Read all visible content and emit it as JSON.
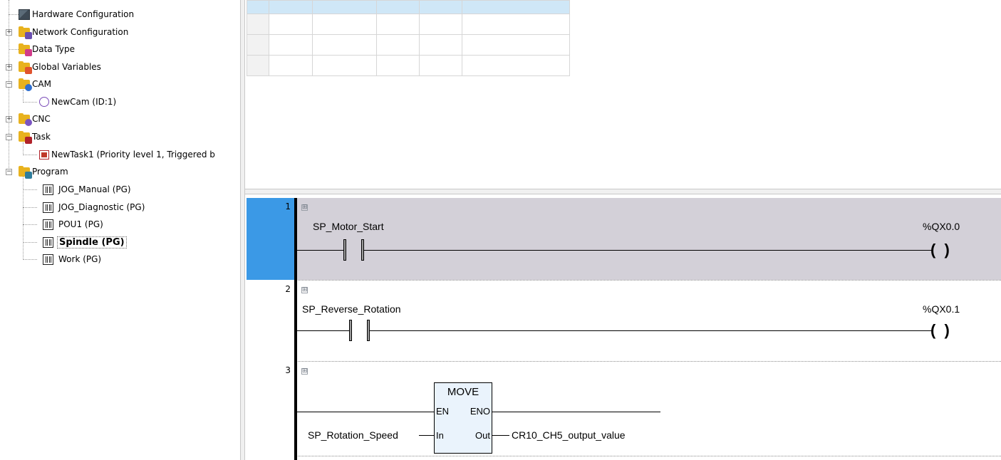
{
  "tree": {
    "items": [
      {
        "label": "Hardware Configuration",
        "icon": "hardware-icon"
      },
      {
        "label": "Network Configuration",
        "icon": "network-icon"
      },
      {
        "label": "Data Type",
        "icon": "data-type-icon"
      },
      {
        "label": "Global Variables",
        "icon": "global-variables-icon"
      },
      {
        "label": "CAM",
        "icon": "cam-folder-icon"
      },
      {
        "label": "NewCam (ID:1)",
        "icon": "cam-icon"
      },
      {
        "label": "CNC",
        "icon": "cnc-icon"
      },
      {
        "label": "Task",
        "icon": "task-folder-icon"
      },
      {
        "label": "NewTask1 (Priority level 1, Triggered b",
        "icon": "task-icon"
      },
      {
        "label": "Program",
        "icon": "program-folder-icon"
      },
      {
        "label": "JOG_Manual (PG)",
        "icon": "pou-icon"
      },
      {
        "label": "JOG_Diagnostic (PG)",
        "icon": "pou-icon"
      },
      {
        "label": "POU1 (PG)",
        "icon": "pou-icon"
      },
      {
        "label": "Spindle (PG)",
        "icon": "pou-icon"
      },
      {
        "label": "Work (PG)",
        "icon": "pou-icon"
      }
    ],
    "expander_plus": "+",
    "expander_minus": "−"
  },
  "ladder": {
    "networks": [
      {
        "number": "1",
        "contact_var": "SP_Motor_Start",
        "coil_var": "%QX0.0",
        "coil_symbol": "(  )"
      },
      {
        "number": "2",
        "contact_var": "SP_Reverse_Rotation",
        "coil_var": "%QX0.1",
        "coil_symbol": "(  )"
      },
      {
        "number": "3"
      }
    ],
    "collapse_symbol": "⊞",
    "move_block": {
      "title": "MOVE",
      "pin_en": "EN",
      "pin_eno": "ENO",
      "pin_in": "In",
      "pin_out": "Out",
      "input_var": "SP_Rotation_Speed",
      "output_var": "CR10_CH5_output_value"
    }
  },
  "colors": {
    "selection": "#3b99e6",
    "selected_network_bg": "#d3d0d8",
    "table_header": "#cfe7f7",
    "block_fill": "#eaf3fc"
  }
}
